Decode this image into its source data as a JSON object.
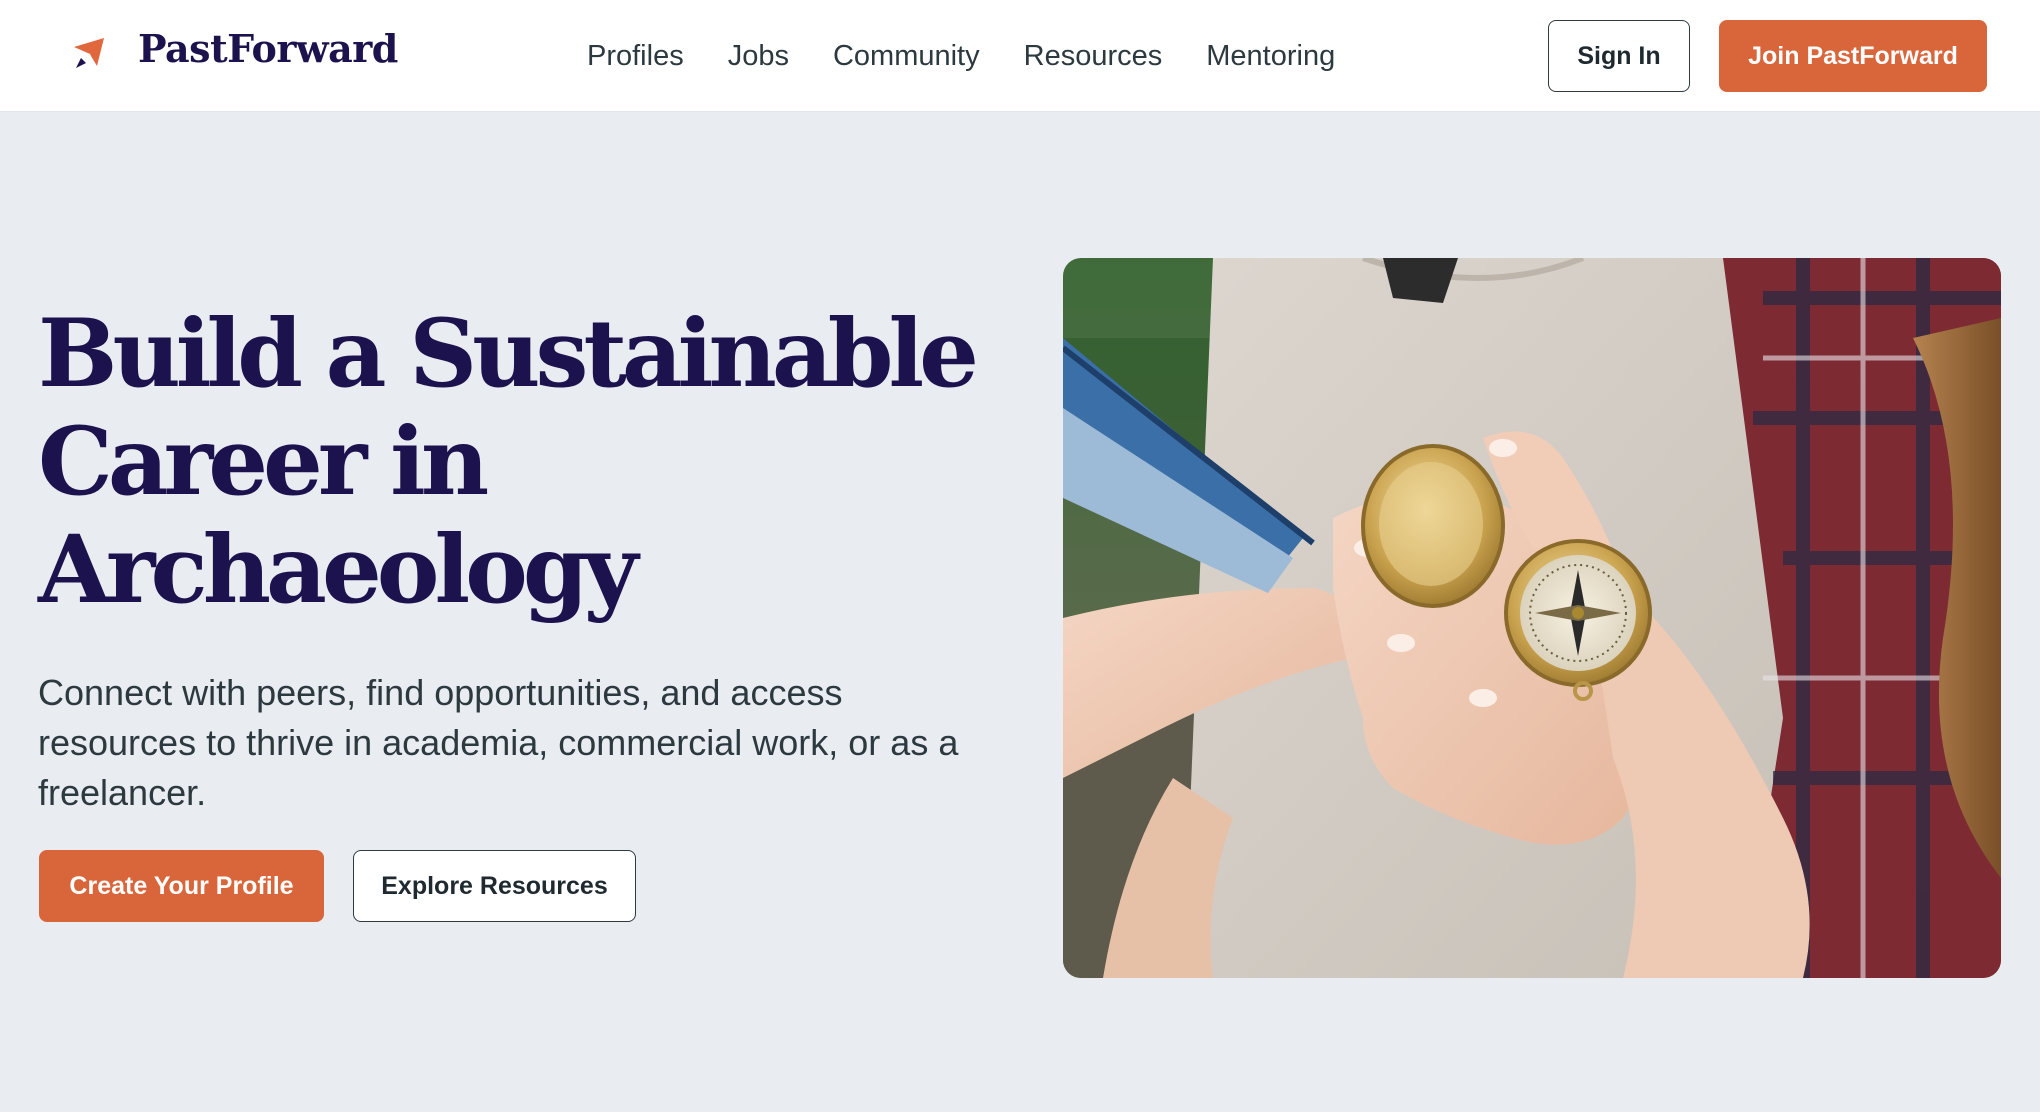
{
  "brand": {
    "name": "PastForward",
    "logo_icon": "paper-plane-arrow-icon",
    "accent_color": "#d9653b",
    "title_color": "#1b124e"
  },
  "nav": {
    "items": [
      {
        "label": "Profiles"
      },
      {
        "label": "Jobs"
      },
      {
        "label": "Community"
      },
      {
        "label": "Resources"
      },
      {
        "label": "Mentoring"
      }
    ]
  },
  "header": {
    "sign_in_label": "Sign In",
    "join_label": "Join PastForward"
  },
  "hero": {
    "title_lines": [
      "Build a Sustainable",
      "Career in",
      "Archaeology"
    ],
    "subtitle": "Connect with peers, find opportunities, and access resources to thrive in academia, commercial work, or as a freelancer.",
    "primary_cta": "Create Your Profile",
    "secondary_cta": "Explore Resources"
  }
}
